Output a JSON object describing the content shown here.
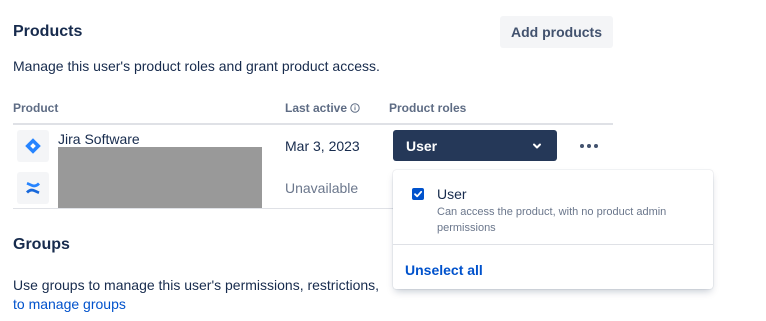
{
  "products": {
    "title": "Products",
    "add_label": "Add products",
    "description": "Manage this user's product roles and grant product access."
  },
  "table": {
    "headers": {
      "product": "Product",
      "last_active": "Last active",
      "roles": "Product roles"
    },
    "rows": [
      {
        "product": "Jira Software",
        "icon": "jira-software-icon",
        "last_active": "Mar 3, 2023",
        "role": "User"
      },
      {
        "product": "",
        "icon": "confluence-icon",
        "last_active": "Unavailable"
      }
    ]
  },
  "dropdown": {
    "option_label": "User",
    "option_checked": true,
    "option_description_line1": "Can access the product, with no product admin",
    "option_description_line2": "permissions",
    "unselect_label": "Unselect all"
  },
  "groups": {
    "title": "Groups",
    "description": "Use groups to manage this user's permissions, restrictions,",
    "link": "to manage groups"
  },
  "colors": {
    "accent": "#0052cc",
    "select_bg": "#253858",
    "text": "#172b4d",
    "muted": "#6b778c"
  }
}
